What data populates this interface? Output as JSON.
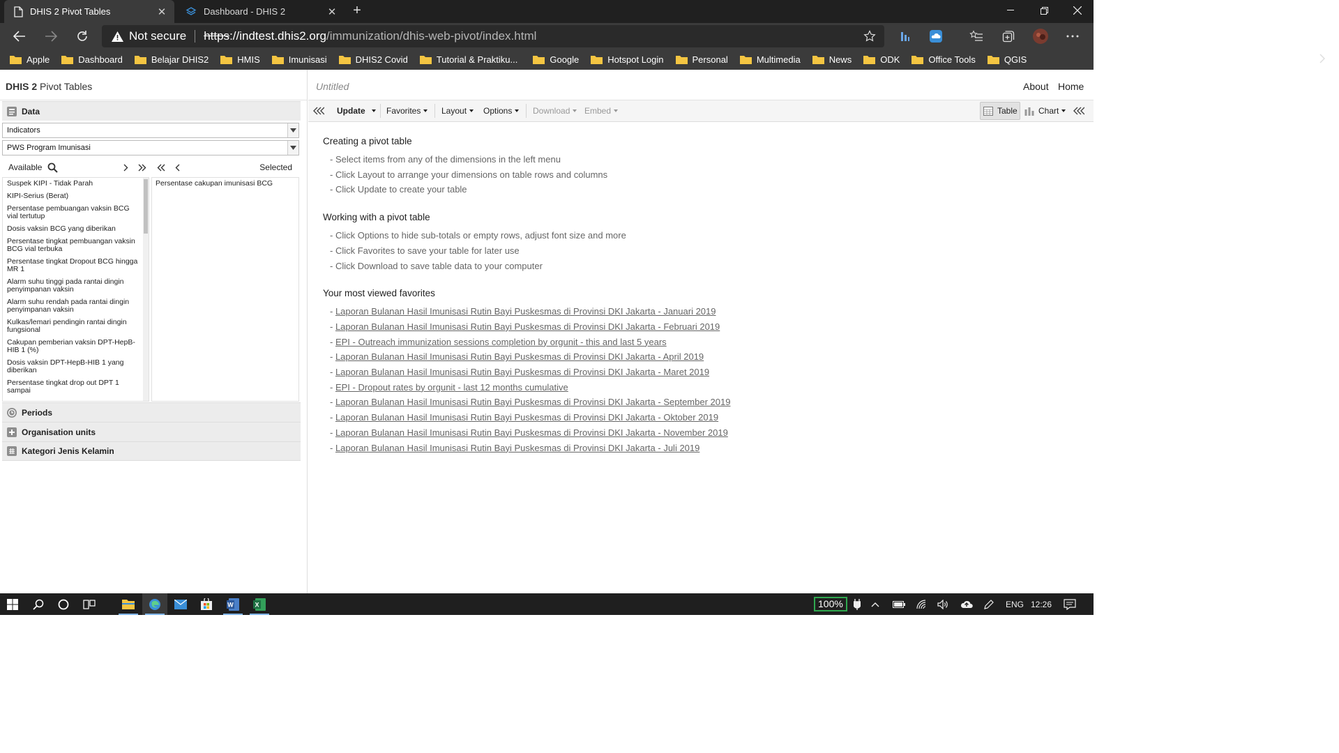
{
  "browser": {
    "tabs": [
      {
        "title": "DHIS 2 Pivot Tables",
        "active": true
      },
      {
        "title": "Dashboard - DHIS 2",
        "active": false
      }
    ],
    "security_label": "Not secure",
    "url_scheme": "https",
    "url_host": "://indtest.dhis2.org",
    "url_path": "/immunization/dhis-web-pivot/index.html",
    "bookmarks": [
      "Apple",
      "Dashboard",
      "Belajar DHIS2",
      "HMIS",
      "Imunisasi",
      "DHIS2 Covid",
      "Tutorial & Praktiku...",
      "Google",
      "Hotspot Login",
      "Personal",
      "Multimedia",
      "News",
      "ODK",
      "Office Tools",
      "QGIS"
    ]
  },
  "app": {
    "brand_bold": "DHIS 2",
    "brand_rest": " Pivot Tables",
    "favorite_title": "Untitled",
    "header_links": {
      "about": "About",
      "home": "Home"
    },
    "data_panel": {
      "title": "Data",
      "data_type": "Indicators",
      "group": "PWS Program Imunisasi",
      "available_label": "Available",
      "selected_label": "Selected",
      "available_items": [
        "Suspek KIPI - Tidak Parah",
        "KIPI-Serius (Berat)",
        "Persentase pembuangan vaksin BCG vial tertutup",
        "Dosis vaksin BCG yang diberikan",
        "Persentase tingkat pembuangan vaksin BCG vial terbuka",
        "Persentase tingkat Dropout BCG hingga MR 1",
        "Alarm suhu tinggi pada rantai dingin penyimpanan vaksin",
        "Alarm suhu rendah pada rantai dingin penyimpanan vaksin",
        "Kulkas/lemari pendingin rantai dingin fungsional",
        "Cakupan pemberian vaksin DPT-HepB-HIB 1 (%)",
        "Dosis vaksin DPT-HepB-HIB 1 yang diberikan",
        "Persentase tingkat drop out DPT 1 sampai"
      ],
      "selected_items": [
        "Persentase cakupan imunisasi BCG"
      ]
    },
    "sections": {
      "periods": "Periods",
      "org_units": "Organisation units",
      "gender": "Kategori Jenis Kelamin"
    },
    "toolbar": {
      "update": "Update",
      "favorites": "Favorites",
      "layout": "Layout",
      "options": "Options",
      "download": "Download",
      "embed": "Embed",
      "table": "Table",
      "chart": "Chart"
    },
    "content": {
      "create_title": "Creating a pivot table",
      "create_steps": [
        "- Select items from any of the dimensions in the left menu",
        "- Click Layout to arrange your dimensions on table rows and columns",
        "- Click Update to create your table"
      ],
      "work_title": "Working with a pivot table",
      "work_steps": [
        "- Click Options to hide sub-totals or empty rows, adjust font size and more",
        "- Click Favorites to save your table for later use",
        "- Click Download to save table data to your computer"
      ],
      "fav_title": "Your most viewed favorites",
      "favorites": [
        "Laporan Bulanan Hasil Imunisasi Rutin Bayi Puskesmas di Provinsi DKI Jakarta - Januari 2019",
        "Laporan Bulanan Hasil Imunisasi Rutin Bayi Puskesmas di Provinsi DKI Jakarta - Februari 2019",
        "EPI - Outreach immunization sessions completion by orgunit - this and last 5 years",
        "Laporan Bulanan Hasil Imunisasi Rutin Bayi Puskesmas di Provinsi DKI Jakarta - April 2019",
        "Laporan Bulanan Hasil Imunisasi Rutin Bayi Puskesmas di Provinsi DKI Jakarta - Maret 2019",
        "EPI - Dropout rates by orgunit - last 12 months cumulative",
        "Laporan Bulanan Hasil Imunisasi Rutin Bayi Puskesmas di Provinsi DKI Jakarta - September 2019",
        "Laporan Bulanan Hasil Imunisasi Rutin Bayi Puskesmas di Provinsi DKI Jakarta - Oktober 2019",
        "Laporan Bulanan Hasil Imunisasi Rutin Bayi Puskesmas di Provinsi DKI Jakarta - November 2019",
        "Laporan Bulanan Hasil Imunisasi Rutin Bayi Puskesmas di Provinsi DKI Jakarta - Juli 2019"
      ]
    }
  },
  "taskbar": {
    "battery": "100%",
    "language": "ENG",
    "time": "12:26"
  },
  "colors": {
    "folder": "#f4c542",
    "edge_accent": "#3a8fd8",
    "battery_green": "#2fa84f"
  }
}
